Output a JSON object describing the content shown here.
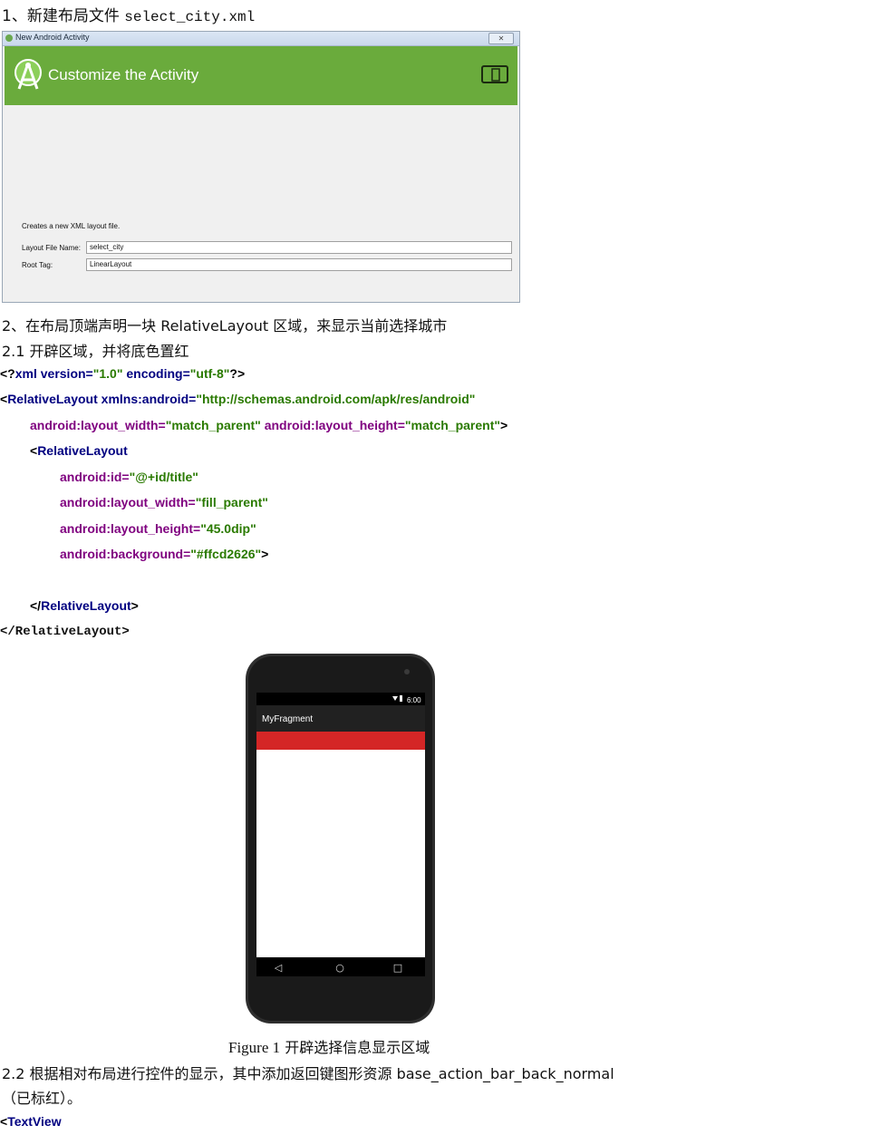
{
  "step1": {
    "num": "1、",
    "text": "新建布局文件",
    "filename": "select_city.xml"
  },
  "dialog": {
    "window_title": "New Android Activity",
    "close_glyph": "✕",
    "heading": "Customize the Activity",
    "description": "Creates a new XML layout file.",
    "fields": [
      {
        "label": "Layout File Name:",
        "value": "select_city"
      },
      {
        "label": "Root Tag:",
        "value": "LinearLayout"
      }
    ],
    "header_color": "#6aab3c"
  },
  "step2": "2、在布局顶端声明一块 RelativeLayout 区域，来显示当前选择城市",
  "step2_1": "2.1  开辟区域，并将底色置红",
  "code": {
    "line1": {
      "open": "<?",
      "tag": "xml",
      "a1": " version=",
      "v1": "\"1.0\"",
      "a2": " encoding=",
      "v2": "\"utf-8\"",
      "close": "?>"
    },
    "line2": {
      "open": "<",
      "tag": "RelativeLayout",
      "a1": " xmlns:android=",
      "v1": "\"http://schemas.android.com/apk/res/android\""
    },
    "line3": {
      "a1": "android:layout_width=",
      "v1": "\"match_parent\"",
      "a2": " android:layout_height=",
      "v2": "\"match_parent\"",
      "close": ">"
    },
    "line4": {
      "open": "<",
      "tag": "RelativeLayout"
    },
    "line5": {
      "a": "android:id=",
      "v": "\"@+id/title\""
    },
    "line6": {
      "a": "android:layout_width=",
      "v": "\"fill_parent\""
    },
    "line7": {
      "a": "android:layout_height=",
      "v": "\"45.0dip\""
    },
    "line8": {
      "a": "android:background=",
      "v": "\"#ffcd2626\"",
      "close": ">"
    },
    "line9": {
      "open": "</",
      "tag": "RelativeLayout",
      "close": ">"
    },
    "line10": "</RelativeLayout>"
  },
  "phone": {
    "status_time": "6:00",
    "app_title": "MyFragment",
    "red_color": "#ffcd2626",
    "nav_back": "◁",
    "nav_home": "○",
    "nav_recent": "□"
  },
  "caption": {
    "fig": "Figure 1",
    "text": "开辟选择信息显示区域"
  },
  "step2_2": "2.2 根据相对布局进行控件的显示，其中添加返回键图形资源 base_action_bar_back_normal",
  "step2_2b": "（已标红）。",
  "last_line": {
    "open": "<",
    "tag": "TextView"
  }
}
